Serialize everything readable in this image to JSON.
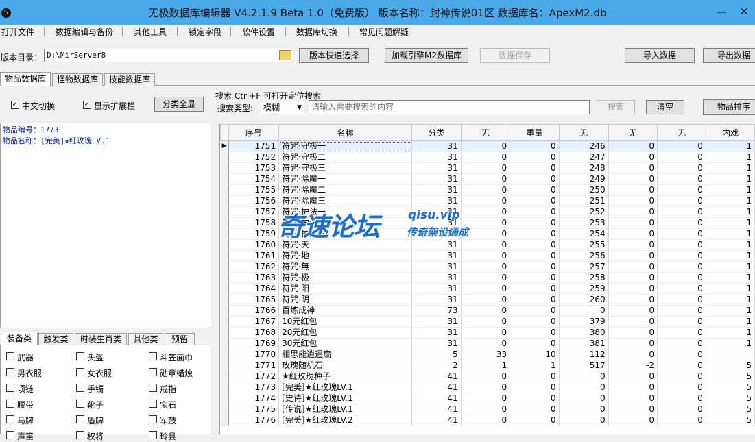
{
  "window": {
    "title": "无极数据库编辑器 V4.2.1.9    Beta 1.0（免费版）    版本名称：封神传说01区    数据库名：ApexM2.db",
    "app_icon_glyph": "S",
    "minimize_glyph": "—",
    "close_glyph": "✕"
  },
  "menu": [
    "打开文件",
    "数据编辑与备份",
    "其他工具",
    "锁定字段",
    "软件设置",
    "数据库切换",
    "常见问题解疑"
  ],
  "toolbar": {
    "dir_label": "版本目录：",
    "dir_value": "D:\\MirServer8",
    "quick_select": "版本快速选择",
    "load_db": "加载引擎M2数据库",
    "save_data": "数据保存",
    "import": "导入数据",
    "export": "导出数据"
  },
  "db_tabs": [
    "物品数据库",
    "怪物数据库",
    "技能数据库"
  ],
  "options": {
    "chinese_switch": "中文切换",
    "show_ext": "显示扩展栏",
    "show_all": "分类全显"
  },
  "search": {
    "hint": "搜索  Ctrl+F 可打开定位搜索",
    "type_label": "搜索类型:",
    "type_value": "模糊",
    "placeholder": "请输入需要搜索的内容",
    "search_btn": "搜索",
    "clear_btn": "清空",
    "sort_btn": "物品排序"
  },
  "info": {
    "line1": "物品编号：1773",
    "line2": "物品名称：[完美]★红玫瑰LV.1"
  },
  "cat_tabs": [
    "装备类",
    "触发类",
    "时装生肖类",
    "其他类",
    "预留"
  ],
  "categories": [
    [
      "武器",
      "头盔",
      "斗笠面巾"
    ],
    [
      "男衣服",
      "女衣服",
      "勋章蜡烛"
    ],
    [
      "项链",
      "手镯",
      "戒指"
    ],
    [
      "腰带",
      "靴子",
      "宝石"
    ],
    [
      "马牌",
      "盾牌",
      "军鼓"
    ],
    [
      "声笛",
      "权将",
      "玲县"
    ]
  ],
  "grid": {
    "columns": [
      "序号",
      "名称",
      "分类",
      "无",
      "重量",
      "无",
      "无",
      "无",
      "内戏"
    ],
    "rows": [
      [
        "1751",
        "符咒·守极一",
        "31",
        "0",
        "0",
        "246",
        "0",
        "0",
        "1"
      ],
      [
        "1752",
        "符咒·守极二",
        "31",
        "0",
        "0",
        "247",
        "0",
        "0",
        "1"
      ],
      [
        "1753",
        "符咒·守极三",
        "31",
        "0",
        "0",
        "248",
        "0",
        "0",
        "1"
      ],
      [
        "1754",
        "符咒·除魔一",
        "31",
        "0",
        "0",
        "249",
        "0",
        "0",
        "1"
      ],
      [
        "1755",
        "符咒·除魔二",
        "31",
        "0",
        "0",
        "250",
        "0",
        "0",
        "1"
      ],
      [
        "1756",
        "符咒·除魔三",
        "31",
        "0",
        "0",
        "251",
        "0",
        "0",
        "1"
      ],
      [
        "1757",
        "符咒·护法一",
        "31",
        "0",
        "0",
        "252",
        "0",
        "0",
        "1"
      ],
      [
        "1758",
        "符咒·护法二",
        "31",
        "0",
        "0",
        "253",
        "0",
        "0",
        "1"
      ],
      [
        "1759",
        "符咒·护法三",
        "31",
        "0",
        "0",
        "254",
        "0",
        "0",
        "1"
      ],
      [
        "1760",
        "符咒·天",
        "31",
        "0",
        "0",
        "255",
        "0",
        "0",
        "1"
      ],
      [
        "1761",
        "符咒·地",
        "31",
        "0",
        "0",
        "256",
        "0",
        "0",
        "1"
      ],
      [
        "1762",
        "符咒·無",
        "31",
        "0",
        "0",
        "257",
        "0",
        "0",
        "1"
      ],
      [
        "1763",
        "符咒·极",
        "31",
        "0",
        "0",
        "258",
        "0",
        "0",
        "1"
      ],
      [
        "1764",
        "符咒·阳",
        "31",
        "0",
        "0",
        "259",
        "0",
        "0",
        "1"
      ],
      [
        "1765",
        "符咒·阴",
        "31",
        "0",
        "0",
        "260",
        "0",
        "0",
        "1"
      ],
      [
        "1766",
        "百炼成神",
        "73",
        "0",
        "0",
        "0",
        "0",
        "0",
        "1"
      ],
      [
        "1767",
        "10元红包",
        "31",
        "0",
        "0",
        "379",
        "0",
        "0",
        "1"
      ],
      [
        "1768",
        "20元红包",
        "31",
        "0",
        "0",
        "380",
        "0",
        "0",
        "1"
      ],
      [
        "1769",
        "30元红包",
        "31",
        "0",
        "0",
        "381",
        "0",
        "0",
        "1"
      ],
      [
        "1770",
        "相思能逍遥扇",
        "5",
        "33",
        "10",
        "112",
        "0",
        "0",
        ""
      ],
      [
        "1771",
        "玫瑰随机石",
        "2",
        "1",
        "1",
        "517",
        "-2",
        "0",
        "5"
      ],
      [
        "1772",
        "★红玫瑰种子",
        "41",
        "0",
        "0",
        "0",
        "0",
        "0",
        "5"
      ],
      [
        "1773",
        "[完美]★红玫瑰LV.1",
        "41",
        "0",
        "0",
        "0",
        "0",
        "0",
        "5"
      ],
      [
        "1774",
        "[史诗]★红玫瑰LV.1",
        "41",
        "0",
        "0",
        "0",
        "0",
        "0",
        "5"
      ],
      [
        "1775",
        "[传说]★红玫瑰LV.1",
        "41",
        "0",
        "0",
        "0",
        "0",
        "0",
        "5"
      ],
      [
        "1776",
        "[完美]★红玫瑰LV.2",
        "41",
        "0",
        "0",
        "0",
        "0",
        "0",
        "5"
      ]
    ]
  },
  "watermark": {
    "main": "奇速论坛",
    "url": "qisu.vip",
    "sub": "传奇架设通成"
  },
  "colors": {
    "titlebar": "#4aa9e8",
    "selected_row": "#e6f1ff",
    "watermark": "#1a6fd6"
  }
}
